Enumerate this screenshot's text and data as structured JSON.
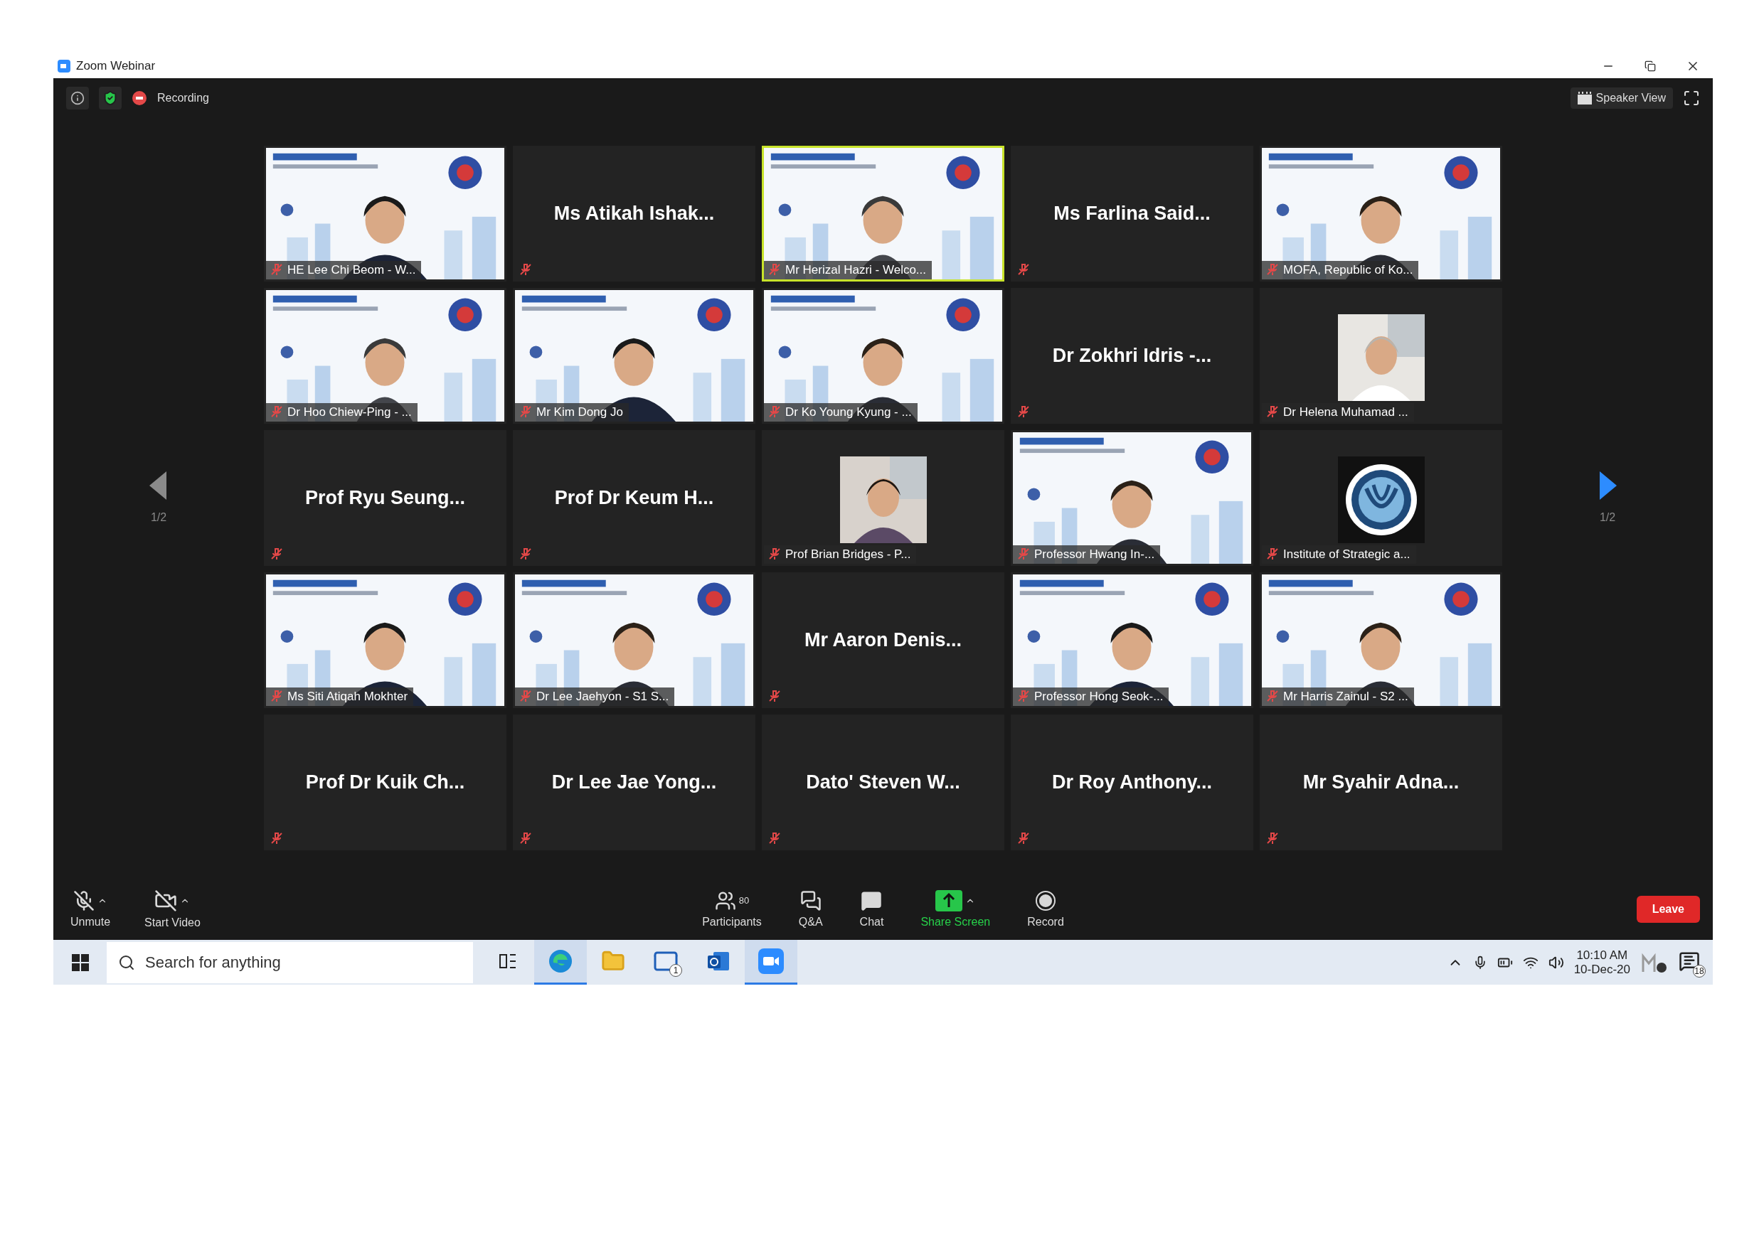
{
  "window": {
    "title": "Zoom Webinar"
  },
  "top_bar": {
    "recording_label": "Recording",
    "view_button": "Speaker View"
  },
  "pager": {
    "left": {
      "label": "1/2",
      "enabled": false
    },
    "right": {
      "label": "1/2",
      "enabled": true
    }
  },
  "tiles": [
    {
      "kind": "video",
      "name": "HE Lee Chi Beom - W...",
      "speaking": false
    },
    {
      "kind": "name",
      "name": "Ms Atikah Ishak...",
      "speaking": false
    },
    {
      "kind": "video",
      "name": "Mr Herizal Hazri - Welco...",
      "speaking": true
    },
    {
      "kind": "name",
      "name": "Ms Farlina Said...",
      "speaking": false
    },
    {
      "kind": "video",
      "name": "MOFA, Republic of Ko...",
      "speaking": false
    },
    {
      "kind": "video",
      "name": "Dr Hoo Chiew-Ping - ...",
      "speaking": false
    },
    {
      "kind": "video",
      "name": "Mr Kim Dong Jo",
      "speaking": false
    },
    {
      "kind": "video",
      "name": "Dr Ko Young Kyung - ...",
      "speaking": false
    },
    {
      "kind": "name",
      "name": "Dr Zokhri Idris -...",
      "speaking": false
    },
    {
      "name": "Dr Helena Muhamad ...",
      "speaking": false
    },
    {
      "kind": "name",
      "name": "Prof Ryu Seung...",
      "speaking": false
    },
    {
      "kind": "name",
      "name": "Prof Dr Keum H...",
      "speaking": false
    },
    {
      "name": "Prof Brian Bridges - P...",
      "speaking": false
    },
    {
      "kind": "video",
      "name": "Professor Hwang In-...",
      "speaking": false
    },
    {
      "kind": "logo",
      "name": "Institute of Strategic a...",
      "speaking": false
    },
    {
      "kind": "video",
      "name": "Ms Siti Atiqah Mokhter",
      "speaking": false
    },
    {
      "kind": "video",
      "name": "Dr Lee Jaehyon - S1 S...",
      "speaking": false
    },
    {
      "kind": "name",
      "name": "Mr Aaron Denis...",
      "speaking": false
    },
    {
      "kind": "video",
      "name": "Professor Hong Seok-...",
      "speaking": false
    },
    {
      "kind": "video",
      "name": "Mr Harris Zainul - S2 ...",
      "speaking": false
    },
    {
      "kind": "name",
      "name": "Prof Dr Kuik Ch...",
      "speaking": false
    },
    {
      "kind": "name",
      "name": "Dr Lee Jae Yong...",
      "speaking": false
    },
    {
      "kind": "name",
      "name": "Dato' Steven W...",
      "speaking": false
    },
    {
      "kind": "name",
      "name": "Dr Roy Anthony...",
      "speaking": false
    },
    {
      "kind": "name",
      "name": "Mr Syahir Adna...",
      "speaking": false
    }
  ],
  "toolbar": {
    "left": [
      {
        "kind": "mic",
        "label": "Unmute",
        "has_menu": true
      },
      {
        "kind": "video",
        "label": "Start Video",
        "has_menu": true
      }
    ],
    "center": [
      {
        "kind": "participants",
        "label": "Participants",
        "count": "80",
        "has_menu": false,
        "highlighted": false
      },
      {
        "kind": "qa",
        "label": "Q&A",
        "has_menu": false,
        "highlighted": false
      },
      {
        "kind": "chat",
        "label": "Chat",
        "has_menu": false,
        "highlighted": false
      },
      {
        "kind": "share",
        "label": "Share Screen",
        "has_menu": true,
        "highlighted": true
      },
      {
        "kind": "record",
        "label": "Record",
        "has_menu": false,
        "highlighted": false
      }
    ],
    "leave": "Leave"
  },
  "taskbar": {
    "search_placeholder": "Search for anything",
    "apps": [
      {
        "kind": "taskview",
        "active": false
      },
      {
        "kind": "edge",
        "active": true
      },
      {
        "kind": "folder",
        "active": false
      },
      {
        "kind": "mail",
        "active": false,
        "badge": "1"
      },
      {
        "kind": "outlook",
        "active": false
      },
      {
        "kind": "zoom",
        "active": true
      }
    ],
    "time": "10:10 AM",
    "date": "10-Dec-20",
    "notification_badge": "18"
  }
}
